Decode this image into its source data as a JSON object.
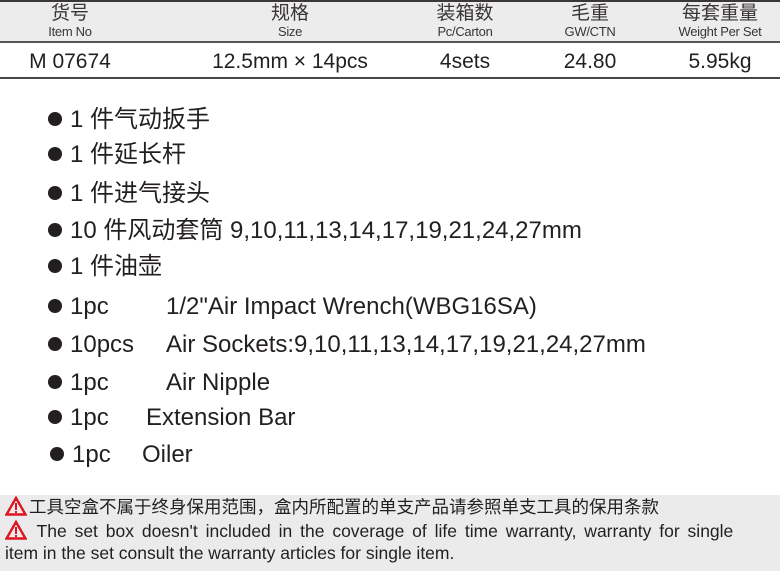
{
  "spec_table": {
    "headers": [
      {
        "cn": "货号",
        "en": "Item No"
      },
      {
        "cn": "规格",
        "en": "Size"
      },
      {
        "cn": "装箱数",
        "en": "Pc/Carton"
      },
      {
        "cn": "毛重",
        "en": "GW/CTN"
      },
      {
        "cn": "每套重量",
        "en": "Weight Per Set"
      }
    ],
    "row": [
      "M 07674",
      "12.5mm × 14pcs",
      "4sets",
      "24.80",
      "5.95kg"
    ]
  },
  "contents_cn": [
    {
      "qty": "1 件",
      "desc": "气动扳手"
    },
    {
      "qty": "1 件",
      "desc": "延长杆"
    },
    {
      "qty": "1 件",
      "desc": "进气接头"
    },
    {
      "qty": "10 件",
      "desc": "风动套筒 9,10,11,13,14,17,19,21,24,27mm"
    },
    {
      "qty": "1 件",
      "desc": "油壶"
    }
  ],
  "contents_en": [
    {
      "qty": "1pc",
      "desc": "1/2\"Air Impact Wrench(WBG16SA)"
    },
    {
      "qty": "10pcs",
      "desc": "Air Sockets:9,10,11,13,14,17,19,21,24,27mm"
    },
    {
      "qty": "1pc",
      "desc": "Air Nipple"
    },
    {
      "qty": "1pc",
      "desc": "Extension Bar"
    },
    {
      "qty": "1pc",
      "desc": "Oiler"
    }
  ],
  "warning": {
    "icon": "warning-triangle-icon",
    "icon_color": "#e0141e",
    "cn": "工具空盒不属于终身保用范围，盒内所配置的单支产品请参照单支工具的保用条款",
    "en_line1": " The set box doesn't included in the coverage of life time warranty, warranty for single",
    "en_line2": "item in the set consult the warranty articles for single item."
  }
}
